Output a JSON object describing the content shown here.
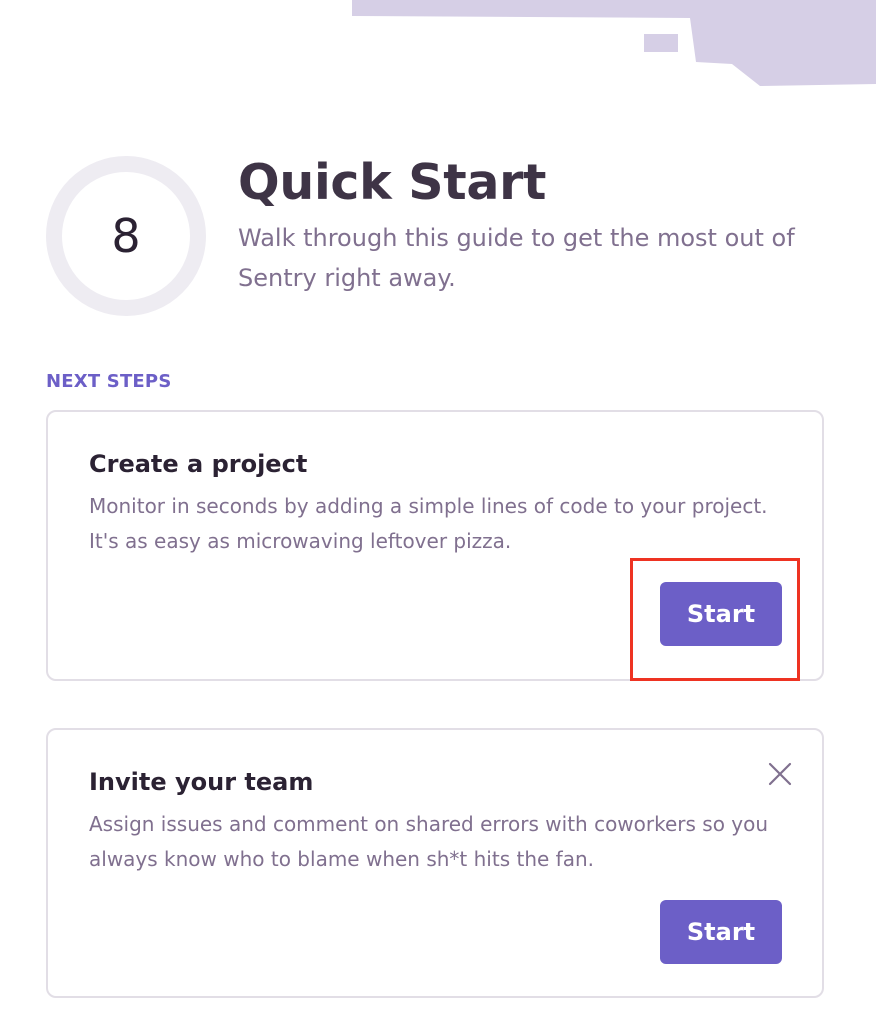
{
  "progress": {
    "count": "8"
  },
  "header": {
    "title": "Quick Start",
    "subtitle": "Walk through this guide to get the most out of Sentry right away."
  },
  "next_steps": {
    "label": "NEXT STEPS"
  },
  "cards": [
    {
      "title": "Create a project",
      "description": "Monitor in seconds by adding a simple lines of code to your project. It's as easy as microwaving leftover pizza.",
      "button_label": "Start",
      "dismissible": false
    },
    {
      "title": "Invite your team",
      "description": "Assign issues and comment on shared errors with coworkers so you always know who to blame when sh*t hits the fan.",
      "button_label": "Start",
      "dismissible": true
    }
  ],
  "icons": {
    "dismiss": "close-icon"
  },
  "colors": {
    "accent": "#6c5fc7",
    "title_text": "#3e3446",
    "muted_text": "#80708f",
    "decor": "#d6cfe6",
    "ring_track": "#eeecf2",
    "card_border": "#e2dee6",
    "highlight": "#ee3322"
  }
}
